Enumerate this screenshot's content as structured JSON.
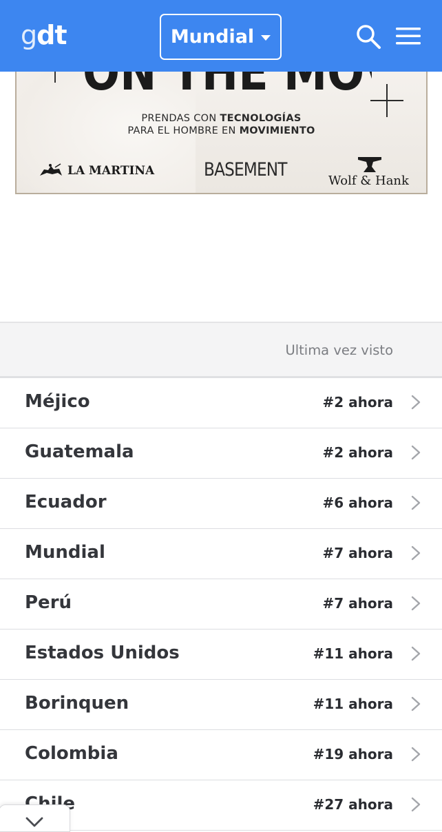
{
  "header": {
    "logo_g": "g",
    "logo_dt": "dt",
    "region_label": "Mundial",
    "icons": {
      "search": "search-icon",
      "menu": "hamburger-menu-icon",
      "dropdown": "caret-down-icon"
    }
  },
  "ad": {
    "headline": "ON THE MOVE",
    "tagline_line1_prefix": "PRENDAS CON ",
    "tagline_line1_bold": "TECNOLOGÍAS",
    "tagline_line2_prefix": "PARA EL HOMBRE EN ",
    "tagline_line2_bold": "MOVIMIENTO",
    "brand1": "LA MARTINA",
    "brand2": "BASEMENT",
    "brand3": "Wolf & Hank"
  },
  "section": {
    "last_seen_label": "Ultima vez visto"
  },
  "items": [
    {
      "name": "Méjico",
      "rank": "#2 ahora"
    },
    {
      "name": "Guatemala",
      "rank": "#2 ahora"
    },
    {
      "name": "Ecuador",
      "rank": "#6 ahora"
    },
    {
      "name": "Mundial",
      "rank": "#7 ahora"
    },
    {
      "name": "Perú",
      "rank": "#7 ahora"
    },
    {
      "name": "Estados Unidos",
      "rank": "#11 ahora"
    },
    {
      "name": "Borinquen",
      "rank": "#11 ahora"
    },
    {
      "name": "Colombia",
      "rank": "#19 ahora"
    },
    {
      "name": "Chile",
      "rank": "#27 ahora"
    }
  ],
  "colors": {
    "header_bg": "#3d86f0",
    "text_primary": "#34363b",
    "text_muted": "#7b7d82",
    "divider": "#dcdde1"
  }
}
